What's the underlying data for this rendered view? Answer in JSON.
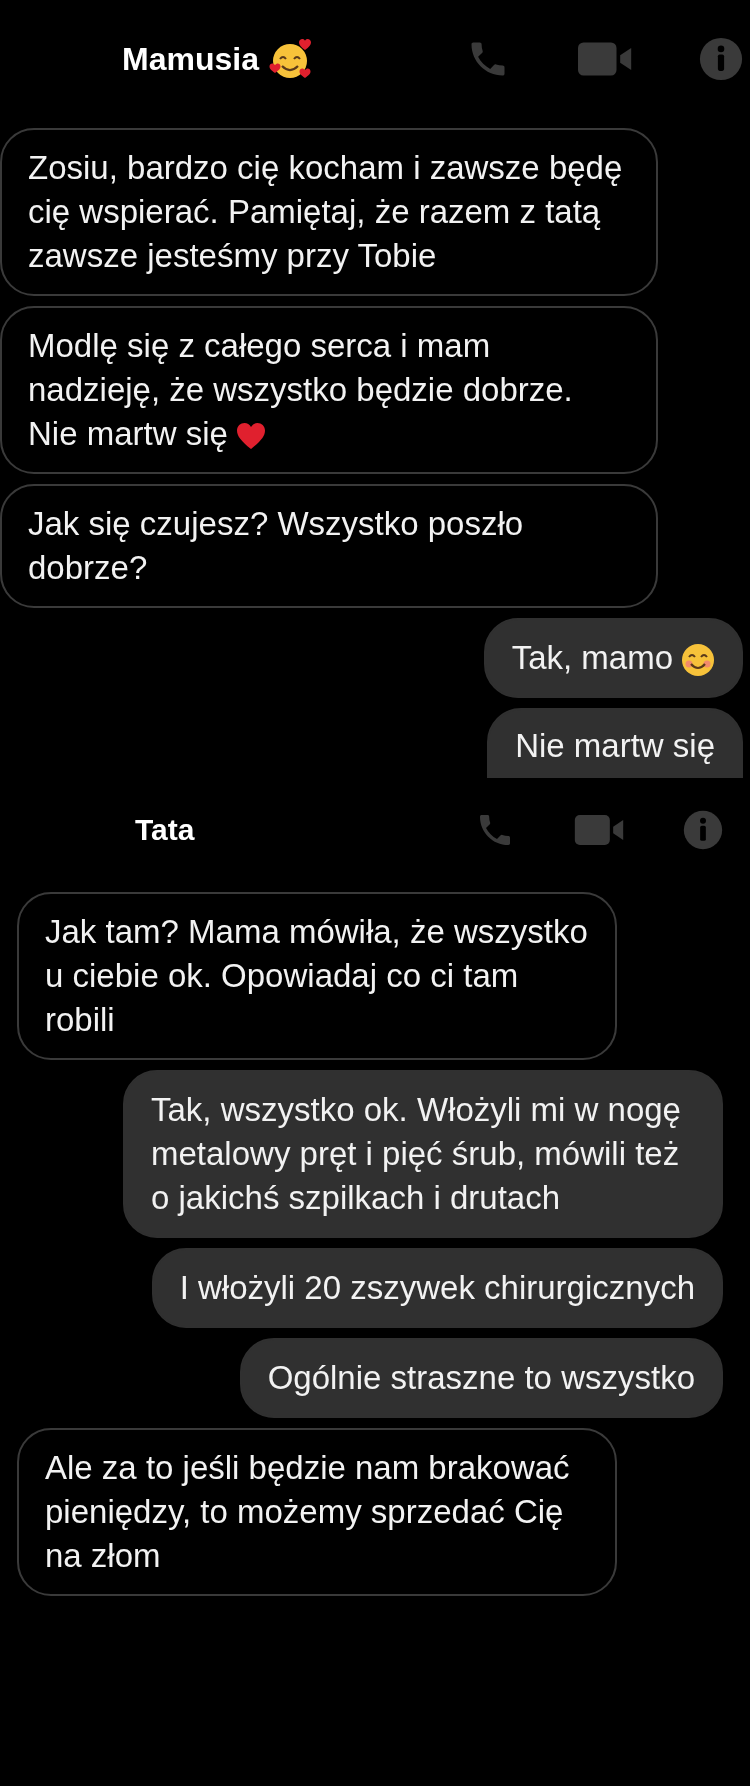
{
  "conversations": [
    {
      "contact": {
        "name": "Mamusia",
        "emoji": {
          "kind": "hearts-smile"
        }
      },
      "messages": [
        {
          "kind": "received",
          "text": "Zosiu, bardzo cię kocham i zawsze będę cię wspierać. Pamiętaj, że razem z tatą zawsze jesteśmy przy Tobie"
        },
        {
          "kind": "received",
          "text": "Modlę się z całego serca i mam nadzieję, że wszystko będzie dobrze. Nie martw się",
          "emoji": {
            "kind": "heart"
          }
        },
        {
          "kind": "received",
          "text": "Jak się czujesz? Wszystko poszło dobrze?"
        },
        {
          "kind": "sent",
          "text": "Tak, mamo",
          "emoji": {
            "kind": "smile"
          }
        },
        {
          "kind": "sent",
          "text": "Nie martw się",
          "cut": true
        }
      ]
    },
    {
      "contact": {
        "name": "Tata"
      },
      "messages": [
        {
          "kind": "received",
          "text": "Jak tam? Mama mówiła, że wszystko u ciebie ok. Opowiadaj co ci tam robili"
        },
        {
          "kind": "sent",
          "text": "Tak, wszystko ok. Włożyli mi w nogę metalowy pręt i pięć śrub, mówili też o jakichś szpilkach i drutach"
        },
        {
          "kind": "sent",
          "text": "I włożyli 20 zszywek chirurgicznych"
        },
        {
          "kind": "sent",
          "text": "Ogólnie straszne to wszystko"
        },
        {
          "kind": "received",
          "text": "Ale za to jeśli będzie nam brakować pieniędzy, to możemy sprzedać Cię na złom"
        }
      ]
    }
  ]
}
